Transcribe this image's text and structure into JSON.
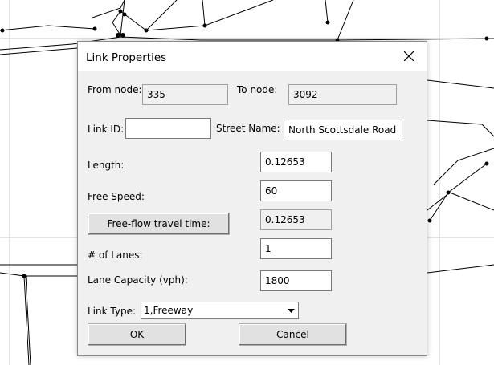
{
  "dialog": {
    "title": "Link Properties",
    "from_node": {
      "label": "From node:",
      "value": "335"
    },
    "to_node": {
      "label": "To node:",
      "value": "3092"
    },
    "link_id": {
      "label": "Link ID:",
      "value": ""
    },
    "street_name": {
      "label": "Street Name:",
      "value": "North Scottsdale Road"
    },
    "length": {
      "label": "Length:",
      "value": "0.12653"
    },
    "free_speed": {
      "label": "Free Speed:",
      "value": "60"
    },
    "travel_time": {
      "button_label": "Free-flow travel time:",
      "value": "0.12653"
    },
    "lanes": {
      "label": "# of Lanes:",
      "value": "1"
    },
    "lane_capacity": {
      "label": "Lane Capacity (vph):",
      "value": "1800"
    },
    "link_type": {
      "label": "Link Type:",
      "selected": "1,Freeway"
    },
    "ok_label": "OK",
    "cancel_label": "Cancel"
  },
  "icons": {
    "close": "close-icon",
    "dropdown": "chevron-down-icon"
  }
}
